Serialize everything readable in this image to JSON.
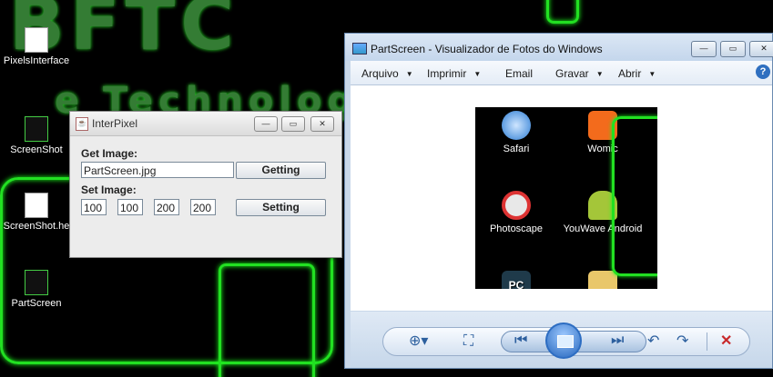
{
  "desktop": {
    "icons": [
      {
        "label": "PixelsInterface"
      },
      {
        "label": "ScreenShot"
      },
      {
        "label": "ScreenShot.he"
      },
      {
        "label": "PartScreen"
      }
    ]
  },
  "interpixel": {
    "title": "InterPixel",
    "get_label": "Get Image:",
    "get_value": "PartScreen.jpg",
    "get_button": "Getting",
    "set_label": "Set Image:",
    "set_values": [
      "100",
      "100",
      "200",
      "200"
    ],
    "set_button": "Setting",
    "controls": {
      "minimize": "—",
      "maximize": "▭",
      "close": "✕"
    }
  },
  "viewer": {
    "title": "PartScreen - Visualizador de Fotos do Windows",
    "menu": [
      "Arquivo",
      "Imprimir",
      "Email",
      "Gravar",
      "Abrir"
    ],
    "help": "?",
    "photo_items": [
      "Safari",
      "Womic",
      "Photoscape",
      "YouWave Android",
      "PC",
      ""
    ],
    "controls": {
      "minimize": "—",
      "maximize": "▭",
      "close": "✕"
    }
  },
  "colors": {
    "neon": "#22e022",
    "desktop_bg": "#000000",
    "viewer_frame": "#c9d8ea",
    "close_red": "#c8282a"
  }
}
